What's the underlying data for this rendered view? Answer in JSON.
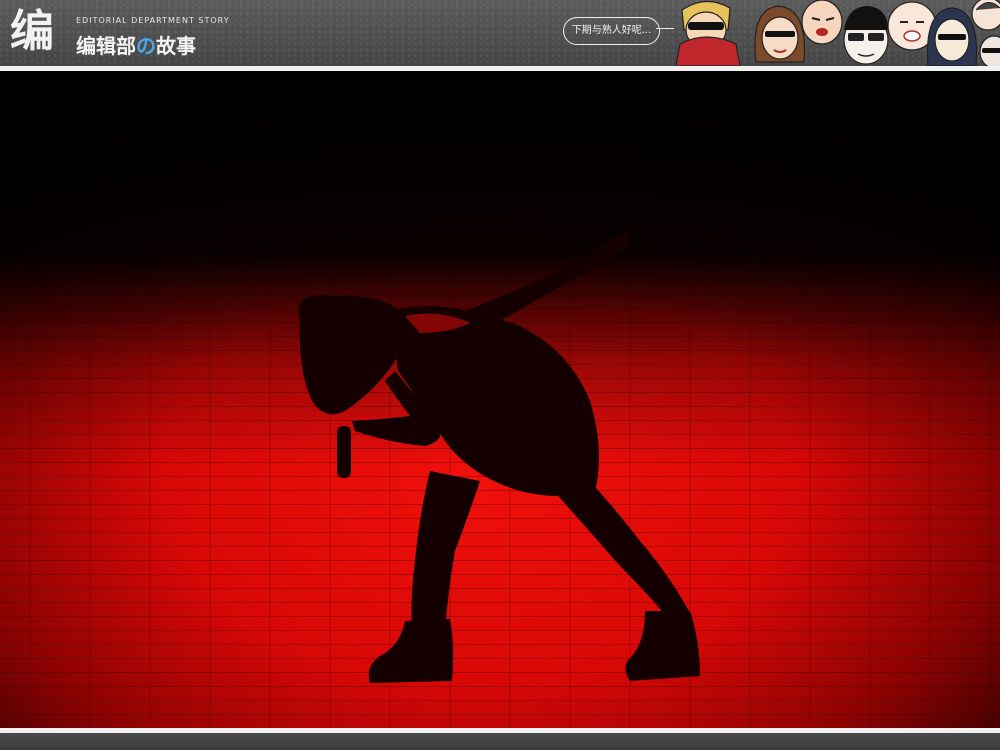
{
  "header": {
    "logo_mark": "编",
    "logo_subtitle": "EDITORIAL DEPARTMENT STORY",
    "logo_title_before": "编辑部",
    "logo_title_no": "の",
    "logo_title_after": "故事",
    "bubble_text": "下期与熟人好呢..."
  },
  "photo": {
    "icon": "stage-performer-photo",
    "colors": {
      "stage_red": "#e60a08",
      "shadow": "#000000"
    }
  }
}
